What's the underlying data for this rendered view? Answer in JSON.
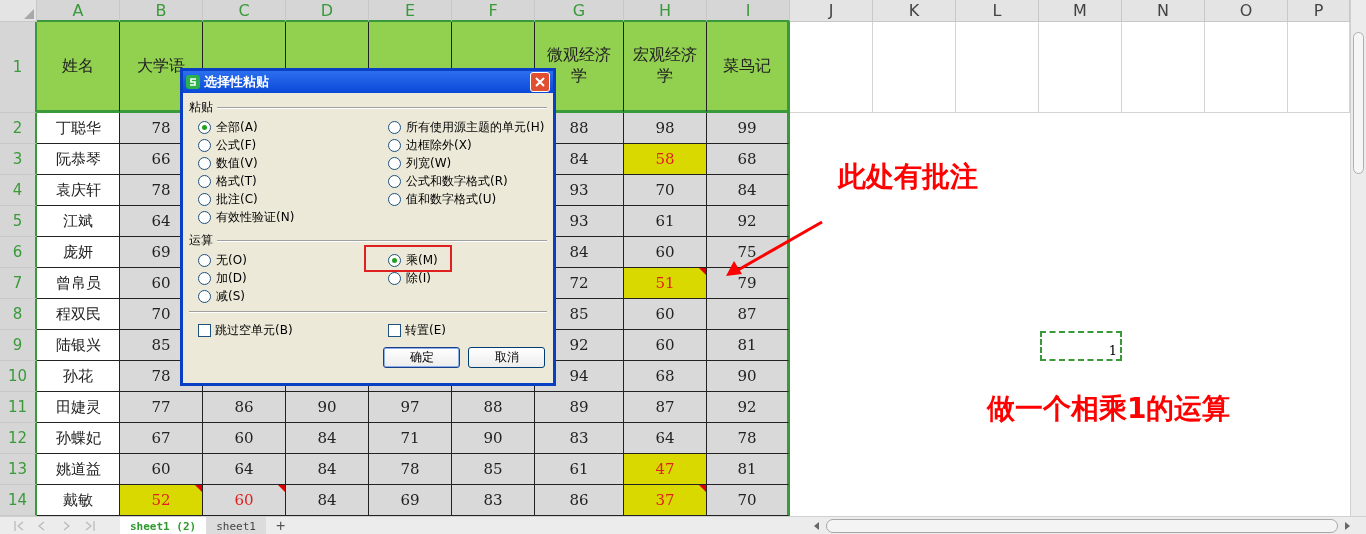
{
  "columns": [
    {
      "label": "A",
      "selected": true
    },
    {
      "label": "B",
      "selected": true
    },
    {
      "label": "C",
      "selected": true
    },
    {
      "label": "D",
      "selected": true
    },
    {
      "label": "E",
      "selected": true
    },
    {
      "label": "F",
      "selected": true
    },
    {
      "label": "G",
      "selected": true
    },
    {
      "label": "H",
      "selected": true
    },
    {
      "label": "I",
      "selected": true
    },
    {
      "label": "J",
      "selected": false
    },
    {
      "label": "K",
      "selected": false
    },
    {
      "label": "L",
      "selected": false
    },
    {
      "label": "M",
      "selected": false
    },
    {
      "label": "N",
      "selected": false
    },
    {
      "label": "O",
      "selected": false
    },
    {
      "label": "P",
      "selected": false
    }
  ],
  "header_row": {
    "row_number": "1",
    "selected": true,
    "cells": [
      "姓名",
      "大学语",
      null,
      null,
      null,
      null,
      "微观经济学",
      "宏观经济学",
      "菜鸟记"
    ]
  },
  "rows": [
    {
      "row_number": "2",
      "selected": true,
      "name": "丁聪华",
      "cells": [
        {
          "text": "78",
          "highlighted": false,
          "emphasized": false,
          "comment": false
        },
        null,
        null,
        null,
        null,
        {
          "text": "88",
          "highlighted": false,
          "emphasized": false,
          "comment": false
        },
        {
          "text": "98",
          "highlighted": false,
          "emphasized": false,
          "comment": false
        },
        {
          "text": "99",
          "highlighted": false,
          "emphasized": false,
          "comment": false
        }
      ]
    },
    {
      "row_number": "3",
      "selected": true,
      "name": "阮恭琴",
      "cells": [
        {
          "text": "66",
          "highlighted": false,
          "emphasized": false,
          "comment": false
        },
        null,
        null,
        null,
        null,
        {
          "text": "84",
          "highlighted": false,
          "emphasized": false,
          "comment": false
        },
        {
          "text": "58",
          "highlighted": true,
          "emphasized": true,
          "comment": false
        },
        {
          "text": "68",
          "highlighted": false,
          "emphasized": false,
          "comment": false
        }
      ]
    },
    {
      "row_number": "4",
      "selected": true,
      "name": "袁庆轩",
      "cells": [
        {
          "text": "78",
          "highlighted": false,
          "emphasized": false,
          "comment": false
        },
        null,
        null,
        null,
        null,
        {
          "text": "93",
          "highlighted": false,
          "emphasized": false,
          "comment": false
        },
        {
          "text": "70",
          "highlighted": false,
          "emphasized": false,
          "comment": false
        },
        {
          "text": "84",
          "highlighted": false,
          "emphasized": false,
          "comment": false
        }
      ]
    },
    {
      "row_number": "5",
      "selected": true,
      "name": "江斌",
      "cells": [
        {
          "text": "64",
          "highlighted": false,
          "emphasized": false,
          "comment": false
        },
        null,
        null,
        null,
        null,
        {
          "text": "93",
          "highlighted": false,
          "emphasized": false,
          "comment": false
        },
        {
          "text": "61",
          "highlighted": false,
          "emphasized": false,
          "comment": false
        },
        {
          "text": "92",
          "highlighted": false,
          "emphasized": false,
          "comment": false
        }
      ]
    },
    {
      "row_number": "6",
      "selected": true,
      "name": "庞妍",
      "cells": [
        {
          "text": "69",
          "highlighted": false,
          "emphasized": false,
          "comment": false
        },
        null,
        null,
        null,
        null,
        {
          "text": "84",
          "highlighted": false,
          "emphasized": false,
          "comment": false
        },
        {
          "text": "60",
          "highlighted": false,
          "emphasized": false,
          "comment": false
        },
        {
          "text": "75",
          "highlighted": false,
          "emphasized": false,
          "comment": false
        }
      ]
    },
    {
      "row_number": "7",
      "selected": true,
      "name": "曾帛员",
      "cells": [
        {
          "text": "60",
          "highlighted": false,
          "emphasized": false,
          "comment": false
        },
        null,
        null,
        null,
        null,
        {
          "text": "72",
          "highlighted": false,
          "emphasized": false,
          "comment": false
        },
        {
          "text": "51",
          "highlighted": true,
          "emphasized": true,
          "comment": true
        },
        {
          "text": "79",
          "highlighted": false,
          "emphasized": false,
          "comment": false
        }
      ]
    },
    {
      "row_number": "8",
      "selected": true,
      "name": "程双民",
      "cells": [
        {
          "text": "70",
          "highlighted": false,
          "emphasized": false,
          "comment": false
        },
        null,
        null,
        null,
        null,
        {
          "text": "85",
          "highlighted": false,
          "emphasized": false,
          "comment": false
        },
        {
          "text": "60",
          "highlighted": false,
          "emphasized": false,
          "comment": false
        },
        {
          "text": "87",
          "highlighted": false,
          "emphasized": false,
          "comment": false
        }
      ]
    },
    {
      "row_number": "9",
      "selected": true,
      "name": "陆银兴",
      "cells": [
        {
          "text": "85",
          "highlighted": false,
          "emphasized": false,
          "comment": false
        },
        null,
        null,
        null,
        null,
        {
          "text": "92",
          "highlighted": false,
          "emphasized": false,
          "comment": false
        },
        {
          "text": "60",
          "highlighted": false,
          "emphasized": false,
          "comment": false
        },
        {
          "text": "81",
          "highlighted": false,
          "emphasized": false,
          "comment": false
        }
      ]
    },
    {
      "row_number": "10",
      "selected": true,
      "name": "孙花",
      "cells": [
        {
          "text": "78",
          "highlighted": false,
          "emphasized": false,
          "comment": false
        },
        null,
        null,
        null,
        null,
        {
          "text": "94",
          "highlighted": false,
          "emphasized": false,
          "comment": false
        },
        {
          "text": "68",
          "highlighted": false,
          "emphasized": false,
          "comment": false
        },
        {
          "text": "90",
          "highlighted": false,
          "emphasized": false,
          "comment": false
        }
      ]
    },
    {
      "row_number": "11",
      "selected": true,
      "name": "田婕灵",
      "cells": [
        {
          "text": "77",
          "highlighted": false,
          "emphasized": false,
          "comment": false
        },
        {
          "text": "86",
          "highlighted": false,
          "emphasized": false,
          "comment": false
        },
        {
          "text": "90",
          "highlighted": false,
          "emphasized": false,
          "comment": false
        },
        {
          "text": "97",
          "highlighted": false,
          "emphasized": false,
          "comment": false
        },
        {
          "text": "88",
          "highlighted": false,
          "emphasized": false,
          "comment": false
        },
        {
          "text": "89",
          "highlighted": false,
          "emphasized": false,
          "comment": false
        },
        {
          "text": "87",
          "highlighted": false,
          "emphasized": false,
          "comment": false
        },
        {
          "text": "92",
          "highlighted": false,
          "emphasized": false,
          "comment": false
        }
      ]
    },
    {
      "row_number": "12",
      "selected": true,
      "name": "孙蝶妃",
      "cells": [
        {
          "text": "67",
          "highlighted": false,
          "emphasized": false,
          "comment": false
        },
        {
          "text": "60",
          "highlighted": false,
          "emphasized": false,
          "comment": false
        },
        {
          "text": "84",
          "highlighted": false,
          "emphasized": false,
          "comment": false
        },
        {
          "text": "71",
          "highlighted": false,
          "emphasized": false,
          "comment": false
        },
        {
          "text": "90",
          "highlighted": false,
          "emphasized": false,
          "comment": false
        },
        {
          "text": "83",
          "highlighted": false,
          "emphasized": false,
          "comment": false
        },
        {
          "text": "64",
          "highlighted": false,
          "emphasized": false,
          "comment": false
        },
        {
          "text": "78",
          "highlighted": false,
          "emphasized": false,
          "comment": false
        }
      ]
    },
    {
      "row_number": "13",
      "selected": true,
      "name": "姚道益",
      "cells": [
        {
          "text": "60",
          "highlighted": false,
          "emphasized": false,
          "comment": false
        },
        {
          "text": "64",
          "highlighted": false,
          "emphasized": false,
          "comment": false
        },
        {
          "text": "84",
          "highlighted": false,
          "emphasized": false,
          "comment": false
        },
        {
          "text": "78",
          "highlighted": false,
          "emphasized": false,
          "comment": false
        },
        {
          "text": "85",
          "highlighted": false,
          "emphasized": false,
          "comment": false
        },
        {
          "text": "61",
          "highlighted": false,
          "emphasized": false,
          "comment": false
        },
        {
          "text": "47",
          "highlighted": true,
          "emphasized": true,
          "comment": false
        },
        {
          "text": "81",
          "highlighted": false,
          "emphasized": false,
          "comment": false
        }
      ]
    },
    {
      "row_number": "14",
      "selected": true,
      "name": "戴敏",
      "cells": [
        {
          "text": "52",
          "highlighted": true,
          "emphasized": true,
          "comment": true
        },
        {
          "text": "60",
          "highlighted": false,
          "emphasized": true,
          "comment": true
        },
        {
          "text": "84",
          "highlighted": false,
          "emphasized": false,
          "comment": false
        },
        {
          "text": "69",
          "highlighted": false,
          "emphasized": false,
          "comment": false
        },
        {
          "text": "83",
          "highlighted": false,
          "emphasized": false,
          "comment": false
        },
        {
          "text": "86",
          "highlighted": false,
          "emphasized": false,
          "comment": false
        },
        {
          "text": "37",
          "highlighted": true,
          "emphasized": true,
          "comment": true
        },
        {
          "text": "70",
          "highlighted": false,
          "emphasized": false,
          "comment": false
        }
      ]
    }
  ],
  "dialog": {
    "title": "选择性粘贴",
    "paste": {
      "label": "粘贴",
      "left_options": [
        {
          "label": "全部(A)",
          "selected": true
        },
        {
          "label": "公式(F)",
          "selected": false
        },
        {
          "label": "数值(V)",
          "selected": false
        },
        {
          "label": "格式(T)",
          "selected": false
        },
        {
          "label": "批注(C)",
          "selected": false
        },
        {
          "label": "有效性验证(N)",
          "selected": false
        }
      ],
      "right_options": [
        {
          "label": "所有使用源主题的单元(H)",
          "selected": false
        },
        {
          "label": "边框除外(X)",
          "selected": false
        },
        {
          "label": "列宽(W)",
          "selected": false
        },
        {
          "label": "公式和数字格式(R)",
          "selected": false
        },
        {
          "label": "值和数字格式(U)",
          "selected": false
        }
      ]
    },
    "operation": {
      "label": "运算",
      "left_options": [
        {
          "label": "无(O)",
          "selected": false,
          "boxed": false
        },
        {
          "label": "加(D)",
          "selected": false,
          "boxed": false
        },
        {
          "label": "减(S)",
          "selected": false,
          "boxed": false
        }
      ],
      "right_options": [
        {
          "label": "乘(M)",
          "selected": true,
          "boxed": true
        },
        {
          "label": "除(I)",
          "selected": false,
          "boxed": false
        }
      ]
    },
    "checkboxes": [
      {
        "label": "跳过空单元(B)",
        "checked": false
      },
      {
        "label": "转置(E)",
        "checked": false
      }
    ],
    "buttons": [
      {
        "label": "确定",
        "default": true
      },
      {
        "label": "取消",
        "default": false
      }
    ]
  },
  "annotations": {
    "comment_note": "此处有批注",
    "value_cell": "1",
    "operation_note": "做一个相乘1的运算"
  },
  "sheet_tabs": [
    {
      "label": "sheet1 (2)",
      "selected": true
    },
    {
      "label": "sheet1",
      "selected": false
    }
  ],
  "add_sheet": "+"
}
